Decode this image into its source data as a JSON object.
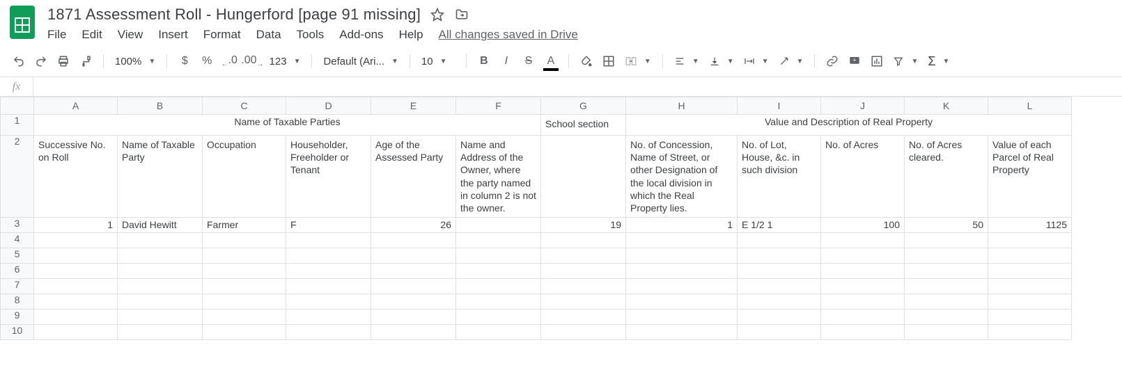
{
  "doc": {
    "title": "1871 Assessment Roll - Hungerford [page 91 missing]"
  },
  "menu": {
    "file": "File",
    "edit": "Edit",
    "view": "View",
    "insert": "Insert",
    "format": "Format",
    "data": "Data",
    "tools": "Tools",
    "addons": "Add-ons",
    "help": "Help",
    "save_status": "All changes saved in Drive"
  },
  "toolbar": {
    "zoom": "100%",
    "currency": "$",
    "percent": "%",
    "dec_less": ".0",
    "dec_more": ".00",
    "numfmt": "123",
    "font": "Default (Ari...",
    "size": "10"
  },
  "formula": {
    "fx": "fx",
    "value": ""
  },
  "columns": [
    "A",
    "B",
    "C",
    "D",
    "E",
    "F",
    "G",
    "H",
    "I",
    "J",
    "K",
    "L"
  ],
  "row_numbers": [
    "1",
    "2",
    "3",
    "4",
    "5",
    "6",
    "7",
    "8",
    "9",
    "10"
  ],
  "headers": {
    "row1": {
      "merge_AF": "Name of Taxable Parties",
      "G": "School section",
      "merge_HL": "Value and Description of Real Property"
    },
    "row2": {
      "A": "Successive No. on Roll",
      "B": "Name of Taxable Party",
      "C": "Occupation",
      "D": "Householder, Freeholder or Tenant",
      "E": "Age of the Assessed Party",
      "F": "Name and Address of the Owner, where the party named in column 2 is not the owner.",
      "G": "",
      "H": "No. of Concession, Name of Street, or other Designation of the local division in which the Real Property lies.",
      "I": "No. of Lot, House, &c. in such division",
      "J": "No. of Acres",
      "K": "No. of Acres cleared.",
      "L": "Value of each Parcel of Real Property"
    }
  },
  "data_row3": {
    "A": "1",
    "B": "David Hewitt",
    "C": "Farmer",
    "D": "F",
    "E": "26",
    "F": "",
    "G": "19",
    "H": "1",
    "I": "E 1/2 1",
    "J": "100",
    "K": "50",
    "L": "1125"
  }
}
